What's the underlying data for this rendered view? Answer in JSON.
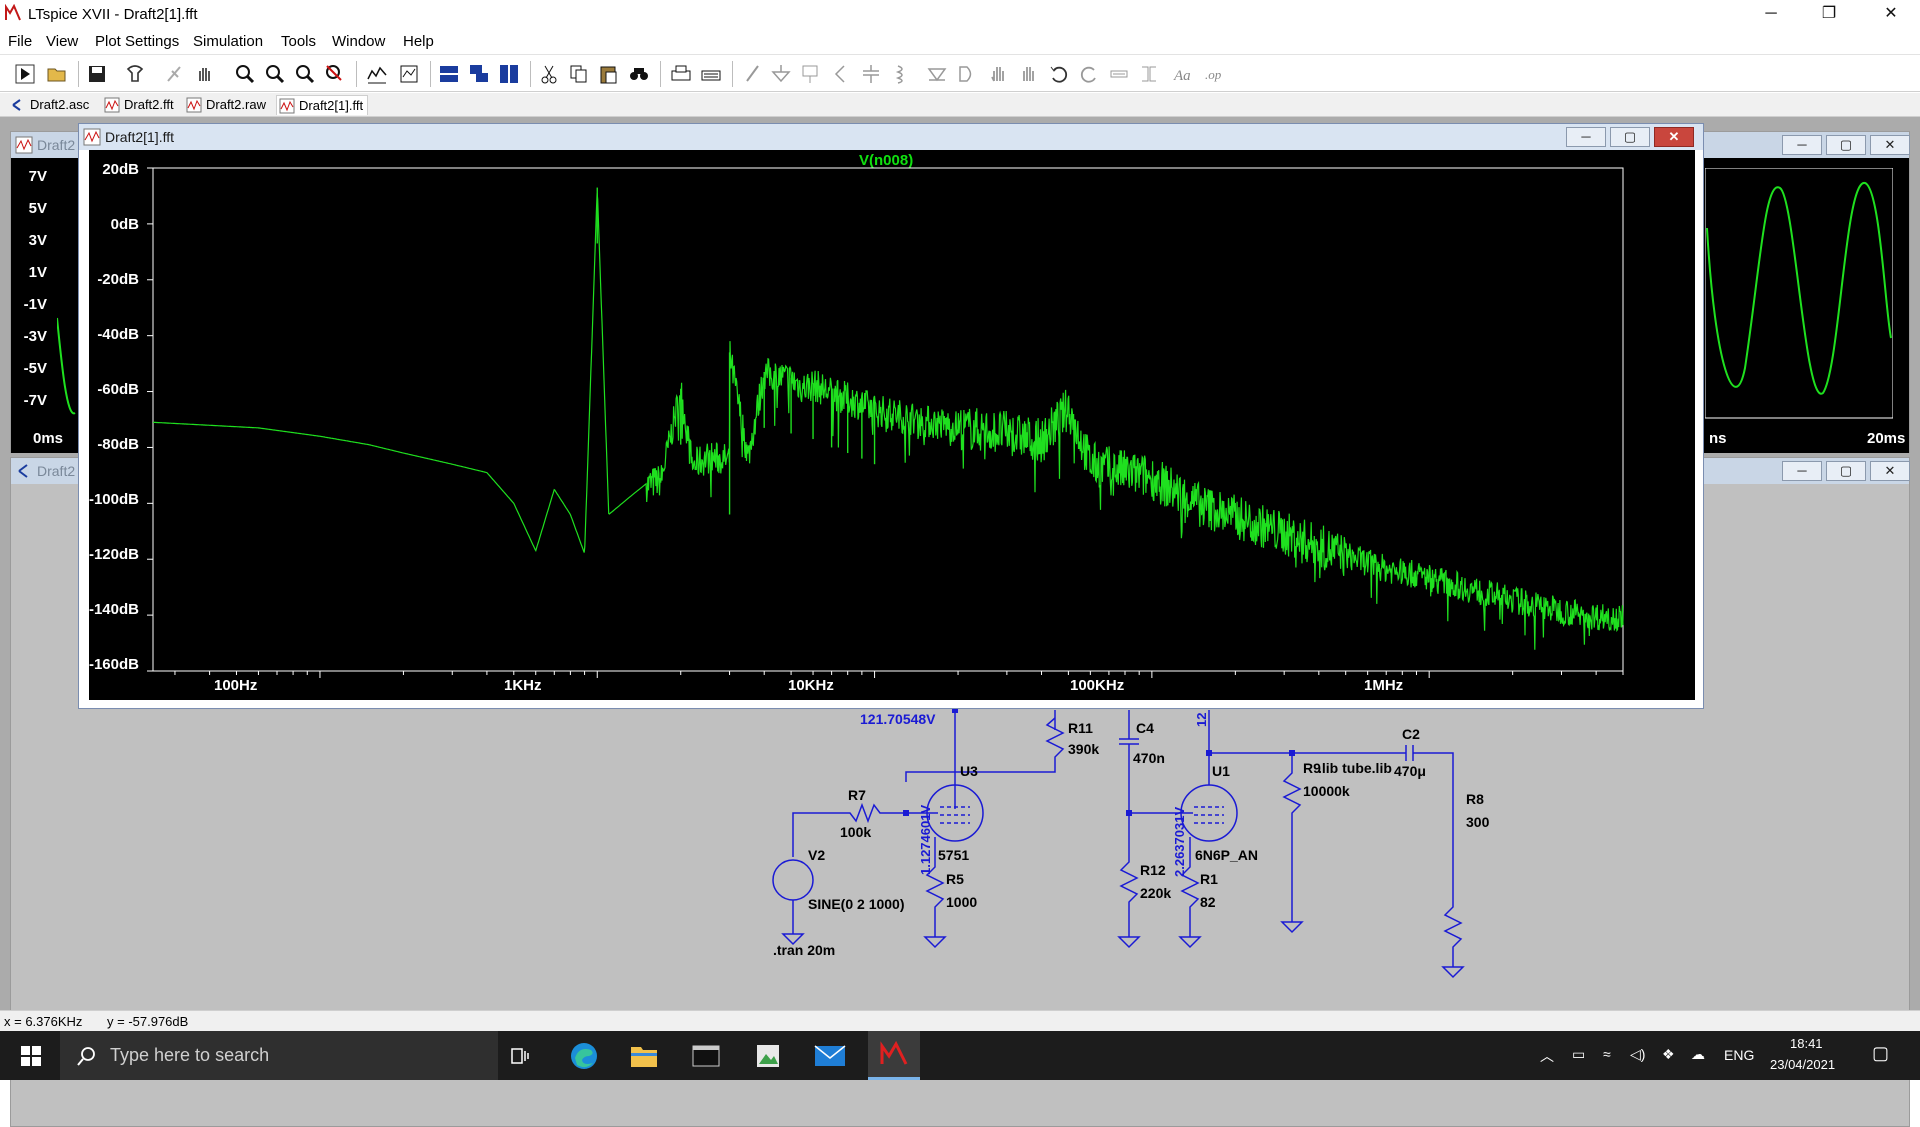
{
  "app": {
    "title": "LTspice XVII - Draft2[1].fft",
    "window_buttons": {
      "minimize": "─",
      "restore": "❐",
      "close": "✕"
    }
  },
  "menu": [
    "File",
    "View",
    "Plot Settings",
    "Simulation",
    "Tools",
    "Window",
    "Help"
  ],
  "toolbar_icons": [
    "run-icon",
    "open-icon",
    "save-icon",
    "control-panel-icon",
    "halt-icon",
    "pan-hand-icon",
    "zoom-in-icon",
    "zoom-out-icon",
    "zoom-fit-icon",
    "zoom-cancel-icon",
    "autorange-icon",
    "manual-limits-icon",
    "tile-horizontal-icon",
    "cascade-icon",
    "tile-vertical-icon",
    "cut-icon",
    "copy-icon",
    "paste-icon",
    "find-icon",
    "print-icon",
    "print-preview-icon",
    "draw-wire-icon",
    "ground-icon",
    "label-net-icon",
    "resistor-icon",
    "capacitor-icon",
    "inductor-icon",
    "diode-icon",
    "component-icon",
    "move-icon",
    "drag-icon",
    "undo-icon",
    "redo-icon",
    "rotate-icon",
    "mirror-icon",
    "text-icon",
    "spice-directive-icon"
  ],
  "tabs": [
    {
      "label": "Draft2.asc",
      "icon": "schematic-icon"
    },
    {
      "label": "Draft2.fft",
      "icon": "waveform-icon"
    },
    {
      "label": "Draft2.raw",
      "icon": "waveform-icon"
    },
    {
      "label": "Draft2[1].fft",
      "icon": "waveform-icon"
    }
  ],
  "bg_windows": {
    "top_title": "Draft2",
    "bottom_title": "Draft2",
    "top_left_ylabels": [
      "7V",
      "5V",
      "3V",
      "1V",
      "-1V",
      "-3V",
      "-5V",
      "-7V"
    ],
    "top_left_x0": "0ms",
    "top_right_x_left": "ns",
    "top_right_x_right": "20ms"
  },
  "fft_window": {
    "title": "Draft2[1].fft",
    "trace_name": "V(n008)",
    "y_ticks": [
      "20dB",
      "0dB",
      "-20dB",
      "-40dB",
      "-60dB",
      "-80dB",
      "-100dB",
      "-120dB",
      "-140dB",
      "-160dB"
    ],
    "x_ticks": [
      "100Hz",
      "1KHz",
      "10KHz",
      "100KHz",
      "1MHz"
    ]
  },
  "chart_data": {
    "type": "line",
    "title": "V(n008)",
    "x_scale": "log",
    "xlim_hz": [
      25,
      5000000
    ],
    "ylim_db": [
      -160,
      20
    ],
    "series": [
      {
        "name": "V(n008)",
        "color": "#1fe01f",
        "points_hz_db": [
          [
            25,
            -71
          ],
          [
            60,
            -73
          ],
          [
            100,
            -76
          ],
          [
            150,
            -79
          ],
          [
            200,
            -82
          ],
          [
            300,
            -86
          ],
          [
            400,
            -89
          ],
          [
            500,
            -100
          ],
          [
            600,
            -117
          ],
          [
            700,
            -95
          ],
          [
            800,
            -104
          ],
          [
            900,
            -118
          ],
          [
            1000,
            13
          ],
          [
            1100,
            -104
          ],
          [
            1300,
            -98
          ],
          [
            1500,
            -93
          ],
          [
            1700,
            -91
          ],
          [
            2000,
            -59
          ],
          [
            2200,
            -86
          ],
          [
            2500,
            -83
          ],
          [
            3000,
            -84
          ],
          [
            3000,
            -46
          ],
          [
            3500,
            -83
          ],
          [
            4000,
            -53
          ],
          [
            5000,
            -55
          ],
          [
            5500,
            -58
          ],
          [
            6000,
            -57
          ],
          [
            7000,
            -60
          ],
          [
            8000,
            -62
          ],
          [
            9000,
            -64
          ],
          [
            10000,
            -66
          ],
          [
            15000,
            -70
          ],
          [
            20000,
            -72
          ],
          [
            30000,
            -74
          ],
          [
            40000,
            -77
          ],
          [
            50000,
            -65
          ],
          [
            60000,
            -85
          ],
          [
            80000,
            -88
          ],
          [
            100000,
            -90
          ],
          [
            150000,
            -100
          ],
          [
            200000,
            -104
          ],
          [
            300000,
            -110
          ],
          [
            500000,
            -118
          ],
          [
            700000,
            -123
          ],
          [
            1000000,
            -126
          ],
          [
            1500000,
            -131
          ],
          [
            2000000,
            -134
          ],
          [
            3000000,
            -138
          ],
          [
            4000000,
            -140
          ],
          [
            5000000,
            -140
          ]
        ]
      }
    ],
    "harmonic_peaks_hz_db": [
      [
        1000,
        13
      ],
      [
        2000,
        -59
      ],
      [
        3000,
        -46
      ],
      [
        4000,
        -53
      ],
      [
        5000,
        -55
      ],
      [
        6000,
        -57
      ],
      [
        7000,
        -59
      ],
      [
        8000,
        -61
      ],
      [
        9000,
        -62
      ],
      [
        10000,
        -63
      ]
    ]
  },
  "schematic": {
    "labels": {
      "node_voltage_top": "121.70548V",
      "node_voltage_u3_cathode": "1.1274601V",
      "node_voltage_u1_cathode": "2.2637031V",
      "node_voltage_u1_plate": "12",
      "r11": "R11",
      "r11_val": "390k",
      "r11_partial": "470n",
      "c4": "C4",
      "c4_val": "470n",
      "u3": "U3",
      "u3_model": "5751",
      "u1": "U1",
      "u1_model": "6N6P_AN",
      "r7": "R7",
      "r7_val": "100k",
      "v2": "V2",
      "v2_val": "SINE(0 2 1000)",
      "r5": "R5",
      "r5_val": "1000",
      "r12": "R12",
      "r12_val": "220k",
      "r1": "R1",
      "r1_val": "82",
      "r9": "R9",
      "r9_val": "10000k",
      "lib": ".lib tube.lib",
      "c2": "C2",
      "c2_val": "470μ",
      "r8": "R8",
      "r8_val": "300",
      "tran": ".tran 20m"
    }
  },
  "status": {
    "x": "x = 6.376KHz",
    "y": "y = -57.976dB"
  },
  "taskbar": {
    "search_placeholder": "Type here to search",
    "language": "ENG",
    "time": "18:41",
    "date": "23/04/2021"
  }
}
